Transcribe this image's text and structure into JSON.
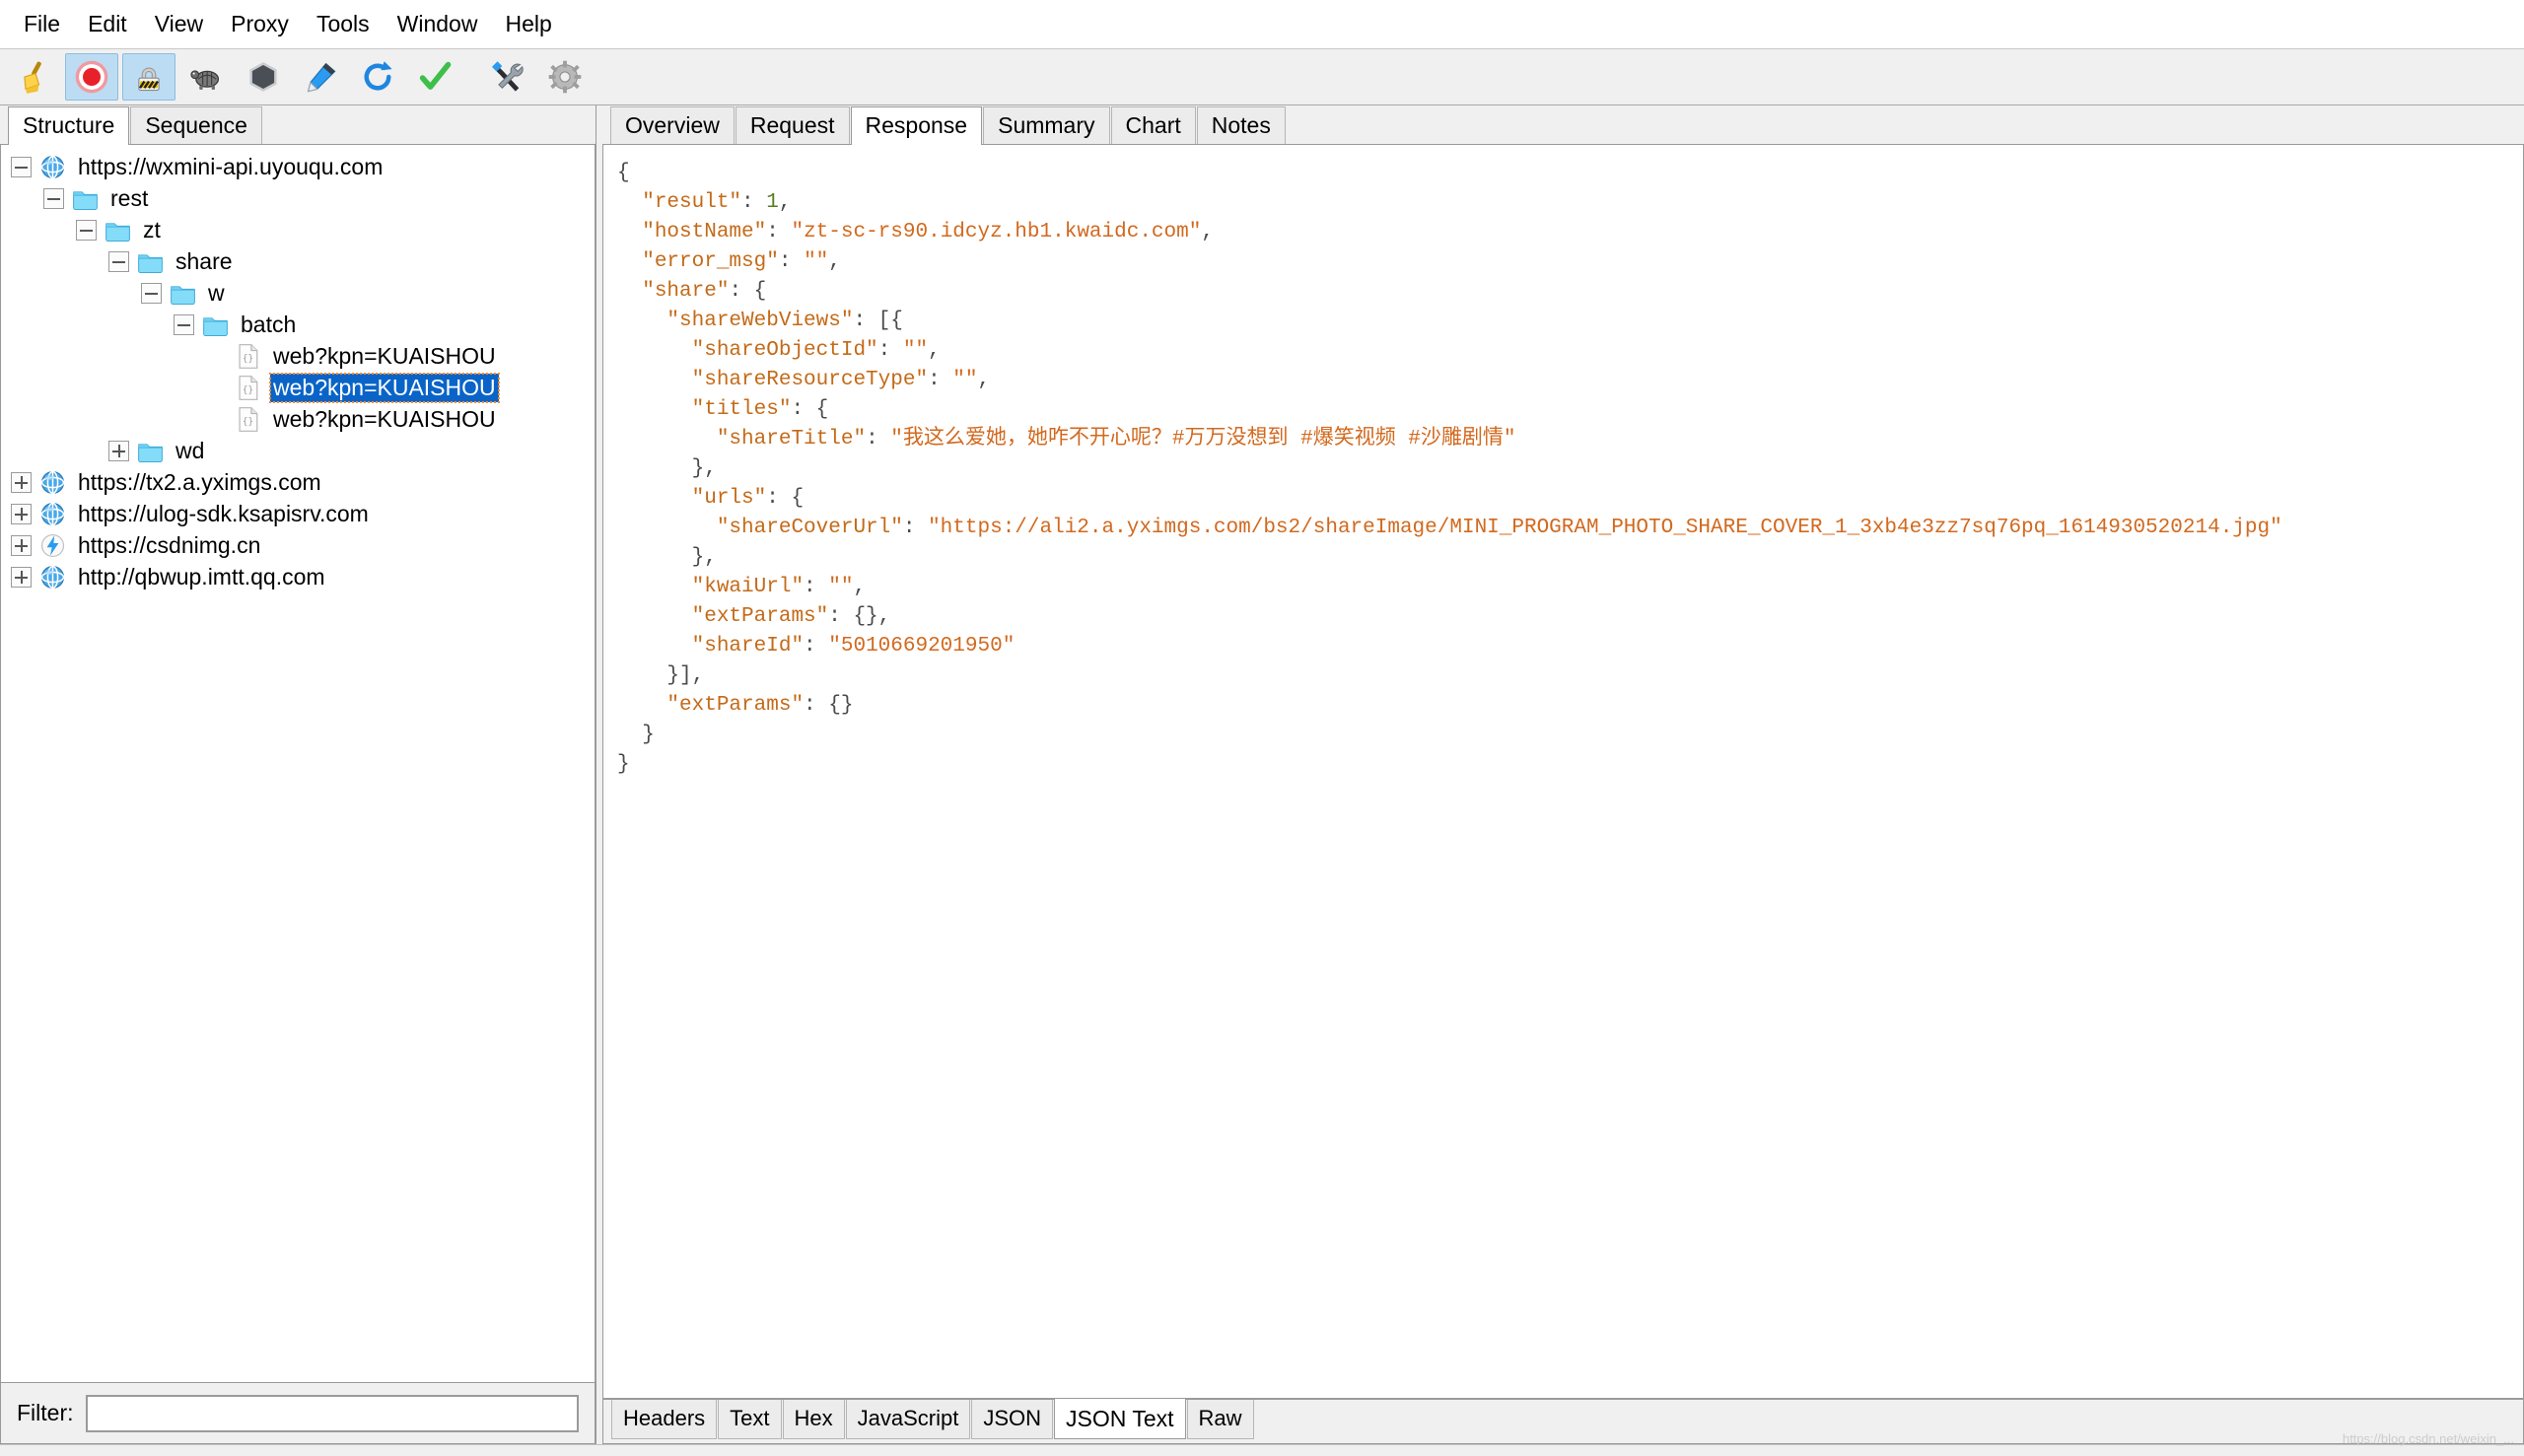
{
  "menubar": {
    "items": [
      {
        "label": "File"
      },
      {
        "label": "Edit"
      },
      {
        "label": "View"
      },
      {
        "label": "Proxy"
      },
      {
        "label": "Tools"
      },
      {
        "label": "Window"
      },
      {
        "label": "Help"
      }
    ]
  },
  "toolbar": {
    "buttons": [
      {
        "name": "clear-session",
        "icon": "broom-icon",
        "active": false
      },
      {
        "name": "start-stop-recording",
        "icon": "record-icon",
        "active": true
      },
      {
        "name": "start-stop-throttling",
        "icon": "throttle-lock-icon",
        "active": true
      },
      {
        "name": "compose-tortoise",
        "icon": "turtle-icon",
        "active": false
      },
      {
        "name": "breakpoints",
        "icon": "hexagon-stop-icon",
        "active": false
      },
      {
        "name": "compose-edit",
        "icon": "pen-icon",
        "active": false
      },
      {
        "name": "repeat-request",
        "icon": "refresh-icon",
        "active": false
      },
      {
        "name": "validate",
        "icon": "check-icon",
        "active": false
      },
      {
        "name": "tools",
        "icon": "wrench-screwdriver-icon",
        "active": false
      },
      {
        "name": "settings",
        "icon": "gear-icon",
        "active": false
      }
    ]
  },
  "left_pane": {
    "tabs": [
      {
        "label": "Structure",
        "selected": true
      },
      {
        "label": "Sequence",
        "selected": false
      }
    ],
    "tree": [
      {
        "label": "https://wxmini-api.uyouqu.com",
        "depth": 0,
        "toggle": "minus",
        "icon": "globe-icon",
        "selected": false
      },
      {
        "label": "rest",
        "depth": 1,
        "toggle": "minus",
        "icon": "folder-icon",
        "selected": false
      },
      {
        "label": "zt",
        "depth": 2,
        "toggle": "minus",
        "icon": "folder-icon",
        "selected": false
      },
      {
        "label": "share",
        "depth": 3,
        "toggle": "minus",
        "icon": "folder-icon",
        "selected": false
      },
      {
        "label": "w",
        "depth": 4,
        "toggle": "minus",
        "icon": "folder-icon",
        "selected": false
      },
      {
        "label": "batch",
        "depth": 5,
        "toggle": "minus",
        "icon": "folder-icon",
        "selected": false
      },
      {
        "label": "web?kpn=KUAISHOU",
        "depth": 6,
        "toggle": "none",
        "icon": "json-file-icon",
        "selected": false
      },
      {
        "label": "web?kpn=KUAISHOU",
        "depth": 6,
        "toggle": "none",
        "icon": "json-file-icon",
        "selected": true
      },
      {
        "label": "web?kpn=KUAISHOU",
        "depth": 6,
        "toggle": "none",
        "icon": "json-file-icon",
        "selected": false
      },
      {
        "label": "wd",
        "depth": 3,
        "toggle": "plus",
        "icon": "folder-icon",
        "selected": false
      },
      {
        "label": "https://tx2.a.yximgs.com",
        "depth": 0,
        "toggle": "plus",
        "icon": "globe-icon",
        "selected": false
      },
      {
        "label": "https://ulog-sdk.ksapisrv.com",
        "depth": 0,
        "toggle": "plus",
        "icon": "globe-icon",
        "selected": false
      },
      {
        "label": "https://csdnimg.cn",
        "depth": 0,
        "toggle": "plus",
        "icon": "bolt-icon",
        "selected": false
      },
      {
        "label": "http://qbwup.imtt.qq.com",
        "depth": 0,
        "toggle": "plus",
        "icon": "globe-icon",
        "selected": false
      }
    ],
    "filter": {
      "label": "Filter:",
      "value": "",
      "placeholder": ""
    }
  },
  "right_pane": {
    "tabs": [
      {
        "label": "Overview",
        "selected": false
      },
      {
        "label": "Request",
        "selected": false
      },
      {
        "label": "Response",
        "selected": true
      },
      {
        "label": "Summary",
        "selected": false
      },
      {
        "label": "Chart",
        "selected": false
      },
      {
        "label": "Notes",
        "selected": false
      }
    ],
    "bottom_tabs": [
      {
        "label": "Headers",
        "selected": false
      },
      {
        "label": "Text",
        "selected": false
      },
      {
        "label": "Hex",
        "selected": false
      },
      {
        "label": "JavaScript",
        "selected": false
      },
      {
        "label": "JSON",
        "selected": false
      },
      {
        "label": "JSON Text",
        "selected": true
      },
      {
        "label": "Raw",
        "selected": false
      }
    ],
    "response_json_lines": [
      [
        {
          "t": "pu",
          "v": "{"
        }
      ],
      [
        {
          "t": "pu",
          "v": "  "
        },
        {
          "t": "pn",
          "v": "\"result\""
        },
        {
          "t": "pu",
          "v": ": "
        },
        {
          "t": "nm",
          "v": "1"
        },
        {
          "t": "pu",
          "v": ","
        }
      ],
      [
        {
          "t": "pu",
          "v": "  "
        },
        {
          "t": "pn",
          "v": "\"hostName\""
        },
        {
          "t": "pu",
          "v": ": "
        },
        {
          "t": "st",
          "v": "\"zt-sc-rs90.idcyz.hb1.kwaidc.com\""
        },
        {
          "t": "pu",
          "v": ","
        }
      ],
      [
        {
          "t": "pu",
          "v": "  "
        },
        {
          "t": "pn",
          "v": "\"error_msg\""
        },
        {
          "t": "pu",
          "v": ": "
        },
        {
          "t": "st",
          "v": "\"\""
        },
        {
          "t": "pu",
          "v": ","
        }
      ],
      [
        {
          "t": "pu",
          "v": "  "
        },
        {
          "t": "pn",
          "v": "\"share\""
        },
        {
          "t": "pu",
          "v": ": {"
        }
      ],
      [
        {
          "t": "pu",
          "v": "    "
        },
        {
          "t": "pn",
          "v": "\"shareWebViews\""
        },
        {
          "t": "pu",
          "v": ": [{"
        }
      ],
      [
        {
          "t": "pu",
          "v": "      "
        },
        {
          "t": "pn",
          "v": "\"shareObjectId\""
        },
        {
          "t": "pu",
          "v": ": "
        },
        {
          "t": "st",
          "v": "\"\""
        },
        {
          "t": "pu",
          "v": ","
        }
      ],
      [
        {
          "t": "pu",
          "v": "      "
        },
        {
          "t": "pn",
          "v": "\"shareResourceType\""
        },
        {
          "t": "pu",
          "v": ": "
        },
        {
          "t": "st",
          "v": "\"\""
        },
        {
          "t": "pu",
          "v": ","
        }
      ],
      [
        {
          "t": "pu",
          "v": "      "
        },
        {
          "t": "pn",
          "v": "\"titles\""
        },
        {
          "t": "pu",
          "v": ": {"
        }
      ],
      [
        {
          "t": "pu",
          "v": "        "
        },
        {
          "t": "pn",
          "v": "\"shareTitle\""
        },
        {
          "t": "pu",
          "v": ": "
        },
        {
          "t": "st",
          "v": "\"我这么爱她，她咋不开心呢？#万万没想到 #爆笑视频 #沙雕剧情\""
        }
      ],
      [
        {
          "t": "pu",
          "v": "      },"
        }
      ],
      [
        {
          "t": "pu",
          "v": "      "
        },
        {
          "t": "pn",
          "v": "\"urls\""
        },
        {
          "t": "pu",
          "v": ": {"
        }
      ],
      [
        {
          "t": "pu",
          "v": "        "
        },
        {
          "t": "pn",
          "v": "\"shareCoverUrl\""
        },
        {
          "t": "pu",
          "v": ": "
        },
        {
          "t": "st",
          "v": "\"https://ali2.a.yximgs.com/bs2/shareImage/MINI_PROGRAM_PHOTO_SHARE_COVER_1_3xb4e3zz7sq76pq_1614930520214.jpg\""
        }
      ],
      [
        {
          "t": "pu",
          "v": "      },"
        }
      ],
      [
        {
          "t": "pu",
          "v": "      "
        },
        {
          "t": "pn",
          "v": "\"kwaiUrl\""
        },
        {
          "t": "pu",
          "v": ": "
        },
        {
          "t": "st",
          "v": "\"\""
        },
        {
          "t": "pu",
          "v": ","
        }
      ],
      [
        {
          "t": "pu",
          "v": "      "
        },
        {
          "t": "pn",
          "v": "\"extParams\""
        },
        {
          "t": "pu",
          "v": ": {},"
        }
      ],
      [
        {
          "t": "pu",
          "v": "      "
        },
        {
          "t": "pn",
          "v": "\"shareId\""
        },
        {
          "t": "pu",
          "v": ": "
        },
        {
          "t": "st",
          "v": "\"5010669201950\""
        }
      ],
      [
        {
          "t": "pu",
          "v": "    }],"
        }
      ],
      [
        {
          "t": "pu",
          "v": "    "
        },
        {
          "t": "pn",
          "v": "\"extParams\""
        },
        {
          "t": "pu",
          "v": ": {}"
        }
      ],
      [
        {
          "t": "pu",
          "v": "  }"
        }
      ],
      [
        {
          "t": "pu",
          "v": "}"
        }
      ]
    ]
  },
  "watermark": "https://blog.csdn.net/weixin_...",
  "colors": {
    "selection_blue": "#0a64c8",
    "focus_orange": "#ff8c2a",
    "toolbar_active": "#bcdcf4",
    "json_key": "#c46a18",
    "json_string": "#d2691e",
    "json_number": "#5a7d1f"
  }
}
